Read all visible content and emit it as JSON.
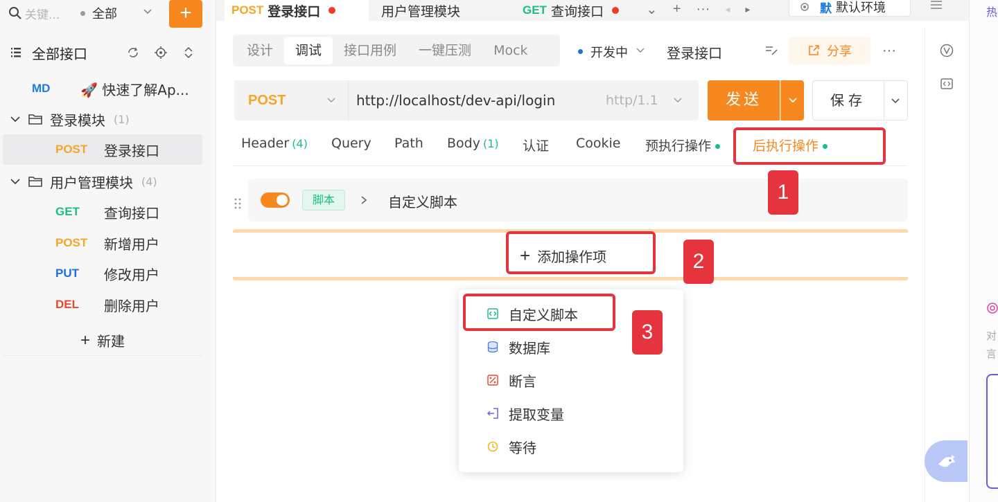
{
  "sidebar": {
    "search_placeholder": "关键...",
    "filter_label": "全部",
    "add_button": "+",
    "tree_title": "全部接口",
    "items": [
      {
        "method": "MD",
        "name": "🚀 快速了解Ap..."
      }
    ],
    "folders": [
      {
        "name": "登录模块",
        "count": "(1)",
        "children": [
          {
            "method": "POST",
            "name": "登录接口"
          }
        ]
      },
      {
        "name": "用户管理模块",
        "count": "(4)",
        "children": [
          {
            "method": "GET",
            "name": "查询接口"
          },
          {
            "method": "POST",
            "name": "新增用户"
          },
          {
            "method": "PUT",
            "name": "修改用户"
          },
          {
            "method": "DEL",
            "name": "删除用户"
          }
        ]
      }
    ],
    "new_label": "新建"
  },
  "tabs": [
    {
      "method": "POST",
      "name": "登录接口"
    },
    {
      "method": "",
      "name": "用户管理模块"
    },
    {
      "method": "GET",
      "name": "查询接口"
    }
  ],
  "tab_tools": {
    "chevron": "⌄",
    "plus": "+",
    "more": "···",
    "prev": "◂",
    "next": "▸"
  },
  "environment": {
    "badge": "默",
    "name": "默认环境"
  },
  "subtabs": [
    "设计",
    "调试",
    "接口用例",
    "一键压测",
    "Mock"
  ],
  "status": "开发中",
  "api_name": "登录接口",
  "share_label": "分享",
  "more_label": "···",
  "request": {
    "method": "POST",
    "url": "http://localhost/dev-api/login",
    "protocol": "http/1.1",
    "send_label": "发送",
    "save_label": "保存"
  },
  "param_tabs": [
    {
      "label": "Header",
      "count": "(4)"
    },
    {
      "label": "Query",
      "count": ""
    },
    {
      "label": "Path",
      "count": ""
    },
    {
      "label": "Body",
      "count": "(1)"
    },
    {
      "label": "认证",
      "count": ""
    },
    {
      "label": "Cookie",
      "count": ""
    },
    {
      "label": "预执行操作",
      "count": ""
    },
    {
      "label": "后执行操作",
      "count": ""
    }
  ],
  "script_row": {
    "tag": "脚本",
    "name": "自定义脚本"
  },
  "add_operation": {
    "plus": "+",
    "label": "添加操作项"
  },
  "dropdown": [
    {
      "label": "自定义脚本",
      "icon": "code-icon"
    },
    {
      "label": "数据库",
      "icon": "database-icon"
    },
    {
      "label": "断言",
      "icon": "assert-icon"
    },
    {
      "label": "提取变量",
      "icon": "extract-icon"
    },
    {
      "label": "等待",
      "icon": "clock-icon"
    }
  ],
  "annotations": [
    "1",
    "2",
    "3"
  ],
  "right_panel": {
    "t1": "热",
    "t2": "对",
    "t3": "言"
  },
  "colors": {
    "accent": "#f7881f",
    "get": "#1bbf83",
    "put": "#1f6fe0",
    "del": "#e8492f",
    "annotation": "#e5343d"
  }
}
